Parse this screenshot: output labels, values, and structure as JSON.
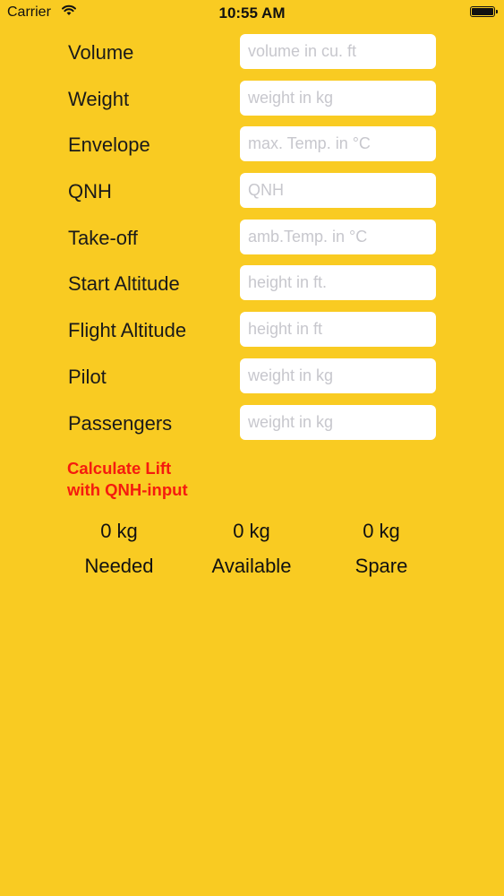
{
  "status_bar": {
    "carrier": "Carrier",
    "time": "10:55 AM"
  },
  "fields": [
    {
      "label": "Volume",
      "placeholder": "volume in cu. ft",
      "value": ""
    },
    {
      "label": "Weight",
      "placeholder": "weight in kg",
      "value": ""
    },
    {
      "label": "Envelope",
      "placeholder": "max. Temp. in °C",
      "value": ""
    },
    {
      "label": "QNH",
      "placeholder": "QNH",
      "value": ""
    },
    {
      "label": "Take-off",
      "placeholder": "amb.Temp. in °C",
      "value": ""
    },
    {
      "label": "Start Altitude",
      "placeholder": "height in ft.",
      "value": ""
    },
    {
      "label": "Flight Altitude",
      "placeholder": "height in ft",
      "value": ""
    },
    {
      "label": "Pilot",
      "placeholder": "weight in kg",
      "value": ""
    },
    {
      "label": "Passengers",
      "placeholder": "weight in kg",
      "value": ""
    }
  ],
  "calculate_button": {
    "line1": "Calculate Lift",
    "line2": "with QNH-input"
  },
  "results": {
    "needed": {
      "value": "0 kg",
      "label": "Needed"
    },
    "available": {
      "value": "0 kg",
      "label": "Available"
    },
    "spare": {
      "value": "0 kg",
      "label": "Spare"
    }
  },
  "colors": {
    "background": "#F9CB22",
    "accent_red": "#F51B0E"
  }
}
